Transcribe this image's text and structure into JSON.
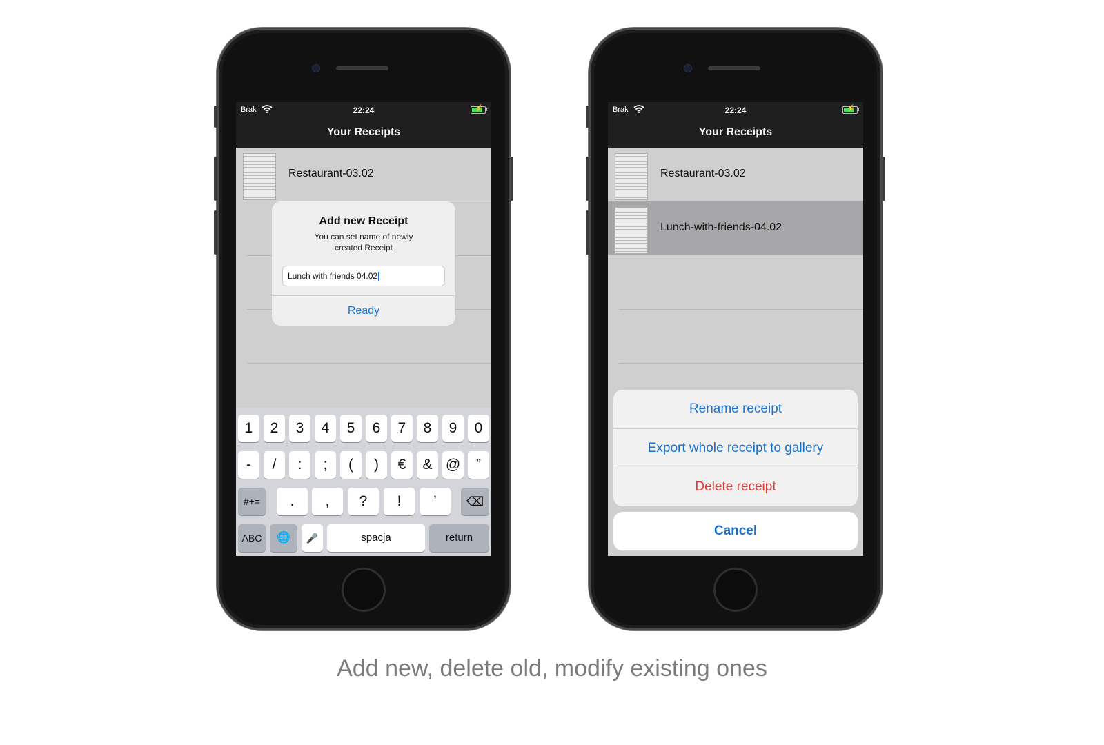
{
  "caption": "Add new, delete old, modify existing ones",
  "status": {
    "carrier": "Brak",
    "time": "22:24"
  },
  "navbar": {
    "title": "Your Receipts"
  },
  "left": {
    "rows": [
      {
        "label": "Restaurant-03.02"
      }
    ],
    "alert": {
      "title": "Add new Receipt",
      "message": "You can set name of newly created Receipt",
      "input_value": "Lunch with friends 04.02",
      "action": "Ready"
    },
    "keyboard": {
      "row1": [
        "1",
        "2",
        "3",
        "4",
        "5",
        "6",
        "7",
        "8",
        "9",
        "0"
      ],
      "row2": [
        "-",
        "/",
        ":",
        ";",
        "(",
        ")",
        "€",
        "&",
        "@",
        "”"
      ],
      "row3_mode": "#+=",
      "row3": [
        ".",
        ",",
        "?",
        "!",
        "’"
      ],
      "row3_delete": "⌫",
      "abc": "ABC",
      "globe": "🌐",
      "mic": "🎤",
      "space": "spacja",
      "return": "return"
    }
  },
  "right": {
    "rows": [
      {
        "label": "Restaurant-03.02"
      },
      {
        "label": "Lunch-with-friends-04.02"
      }
    ],
    "sheet": {
      "rename": "Rename receipt",
      "export": "Export whole receipt to gallery",
      "delete": "Delete receipt",
      "cancel": "Cancel"
    }
  },
  "colors": {
    "accent": "#1a73d0",
    "destructive": "#e0372f",
    "bar": "#1f1f1f"
  }
}
